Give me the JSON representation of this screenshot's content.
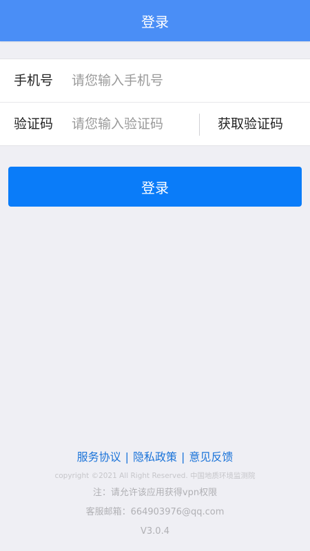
{
  "header": {
    "title": "登录"
  },
  "form": {
    "phone": {
      "label": "手机号",
      "placeholder": "请您输入手机号",
      "value": ""
    },
    "code": {
      "label": "验证码",
      "placeholder": "请您输入验证码",
      "value": ""
    },
    "get_code_label": "获取验证码"
  },
  "login_button_label": "登录",
  "footer": {
    "links": [
      "服务协议",
      "隐私政策",
      "意见反馈"
    ],
    "separator": "|",
    "copyright": "copyright ©2021 All Right Reserved. 中国地质环境监测院",
    "note": "注：请允许该应用获得vpn权限",
    "email": "客服邮箱：664903976@qq.com",
    "version": "V3.0.4"
  },
  "colors": {
    "header_bg": "#4a8ef6",
    "button_bg": "#0a7cf9",
    "link": "#1a73d9",
    "page_bg": "#efeff4"
  }
}
